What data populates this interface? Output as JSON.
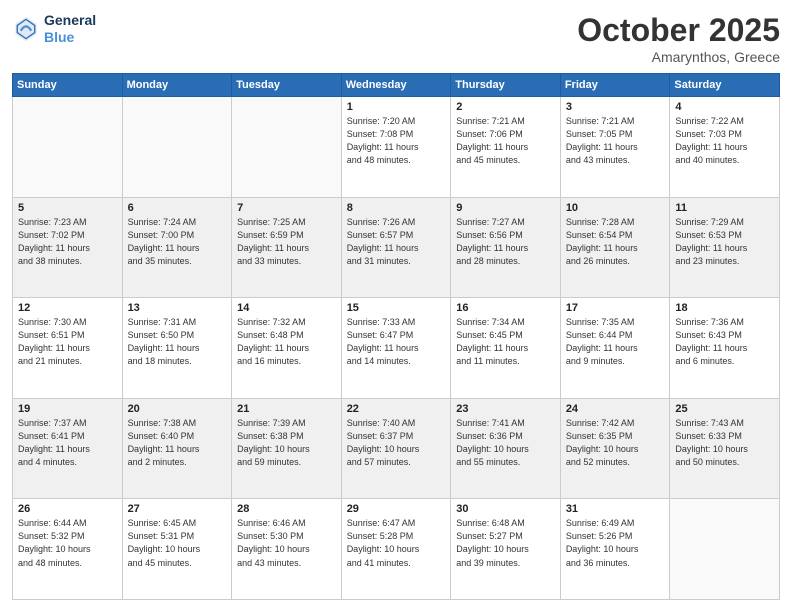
{
  "header": {
    "logo_line1": "General",
    "logo_line2": "Blue",
    "month": "October 2025",
    "location": "Amarynthos, Greece"
  },
  "weekdays": [
    "Sunday",
    "Monday",
    "Tuesday",
    "Wednesday",
    "Thursday",
    "Friday",
    "Saturday"
  ],
  "weeks": [
    [
      {
        "day": "",
        "info": ""
      },
      {
        "day": "",
        "info": ""
      },
      {
        "day": "",
        "info": ""
      },
      {
        "day": "1",
        "info": "Sunrise: 7:20 AM\nSunset: 7:08 PM\nDaylight: 11 hours\nand 48 minutes."
      },
      {
        "day": "2",
        "info": "Sunrise: 7:21 AM\nSunset: 7:06 PM\nDaylight: 11 hours\nand 45 minutes."
      },
      {
        "day": "3",
        "info": "Sunrise: 7:21 AM\nSunset: 7:05 PM\nDaylight: 11 hours\nand 43 minutes."
      },
      {
        "day": "4",
        "info": "Sunrise: 7:22 AM\nSunset: 7:03 PM\nDaylight: 11 hours\nand 40 minutes."
      }
    ],
    [
      {
        "day": "5",
        "info": "Sunrise: 7:23 AM\nSunset: 7:02 PM\nDaylight: 11 hours\nand 38 minutes."
      },
      {
        "day": "6",
        "info": "Sunrise: 7:24 AM\nSunset: 7:00 PM\nDaylight: 11 hours\nand 35 minutes."
      },
      {
        "day": "7",
        "info": "Sunrise: 7:25 AM\nSunset: 6:59 PM\nDaylight: 11 hours\nand 33 minutes."
      },
      {
        "day": "8",
        "info": "Sunrise: 7:26 AM\nSunset: 6:57 PM\nDaylight: 11 hours\nand 31 minutes."
      },
      {
        "day": "9",
        "info": "Sunrise: 7:27 AM\nSunset: 6:56 PM\nDaylight: 11 hours\nand 28 minutes."
      },
      {
        "day": "10",
        "info": "Sunrise: 7:28 AM\nSunset: 6:54 PM\nDaylight: 11 hours\nand 26 minutes."
      },
      {
        "day": "11",
        "info": "Sunrise: 7:29 AM\nSunset: 6:53 PM\nDaylight: 11 hours\nand 23 minutes."
      }
    ],
    [
      {
        "day": "12",
        "info": "Sunrise: 7:30 AM\nSunset: 6:51 PM\nDaylight: 11 hours\nand 21 minutes."
      },
      {
        "day": "13",
        "info": "Sunrise: 7:31 AM\nSunset: 6:50 PM\nDaylight: 11 hours\nand 18 minutes."
      },
      {
        "day": "14",
        "info": "Sunrise: 7:32 AM\nSunset: 6:48 PM\nDaylight: 11 hours\nand 16 minutes."
      },
      {
        "day": "15",
        "info": "Sunrise: 7:33 AM\nSunset: 6:47 PM\nDaylight: 11 hours\nand 14 minutes."
      },
      {
        "day": "16",
        "info": "Sunrise: 7:34 AM\nSunset: 6:45 PM\nDaylight: 11 hours\nand 11 minutes."
      },
      {
        "day": "17",
        "info": "Sunrise: 7:35 AM\nSunset: 6:44 PM\nDaylight: 11 hours\nand 9 minutes."
      },
      {
        "day": "18",
        "info": "Sunrise: 7:36 AM\nSunset: 6:43 PM\nDaylight: 11 hours\nand 6 minutes."
      }
    ],
    [
      {
        "day": "19",
        "info": "Sunrise: 7:37 AM\nSunset: 6:41 PM\nDaylight: 11 hours\nand 4 minutes."
      },
      {
        "day": "20",
        "info": "Sunrise: 7:38 AM\nSunset: 6:40 PM\nDaylight: 11 hours\nand 2 minutes."
      },
      {
        "day": "21",
        "info": "Sunrise: 7:39 AM\nSunset: 6:38 PM\nDaylight: 10 hours\nand 59 minutes."
      },
      {
        "day": "22",
        "info": "Sunrise: 7:40 AM\nSunset: 6:37 PM\nDaylight: 10 hours\nand 57 minutes."
      },
      {
        "day": "23",
        "info": "Sunrise: 7:41 AM\nSunset: 6:36 PM\nDaylight: 10 hours\nand 55 minutes."
      },
      {
        "day": "24",
        "info": "Sunrise: 7:42 AM\nSunset: 6:35 PM\nDaylight: 10 hours\nand 52 minutes."
      },
      {
        "day": "25",
        "info": "Sunrise: 7:43 AM\nSunset: 6:33 PM\nDaylight: 10 hours\nand 50 minutes."
      }
    ],
    [
      {
        "day": "26",
        "info": "Sunrise: 6:44 AM\nSunset: 5:32 PM\nDaylight: 10 hours\nand 48 minutes."
      },
      {
        "day": "27",
        "info": "Sunrise: 6:45 AM\nSunset: 5:31 PM\nDaylight: 10 hours\nand 45 minutes."
      },
      {
        "day": "28",
        "info": "Sunrise: 6:46 AM\nSunset: 5:30 PM\nDaylight: 10 hours\nand 43 minutes."
      },
      {
        "day": "29",
        "info": "Sunrise: 6:47 AM\nSunset: 5:28 PM\nDaylight: 10 hours\nand 41 minutes."
      },
      {
        "day": "30",
        "info": "Sunrise: 6:48 AM\nSunset: 5:27 PM\nDaylight: 10 hours\nand 39 minutes."
      },
      {
        "day": "31",
        "info": "Sunrise: 6:49 AM\nSunset: 5:26 PM\nDaylight: 10 hours\nand 36 minutes."
      },
      {
        "day": "",
        "info": ""
      }
    ]
  ]
}
